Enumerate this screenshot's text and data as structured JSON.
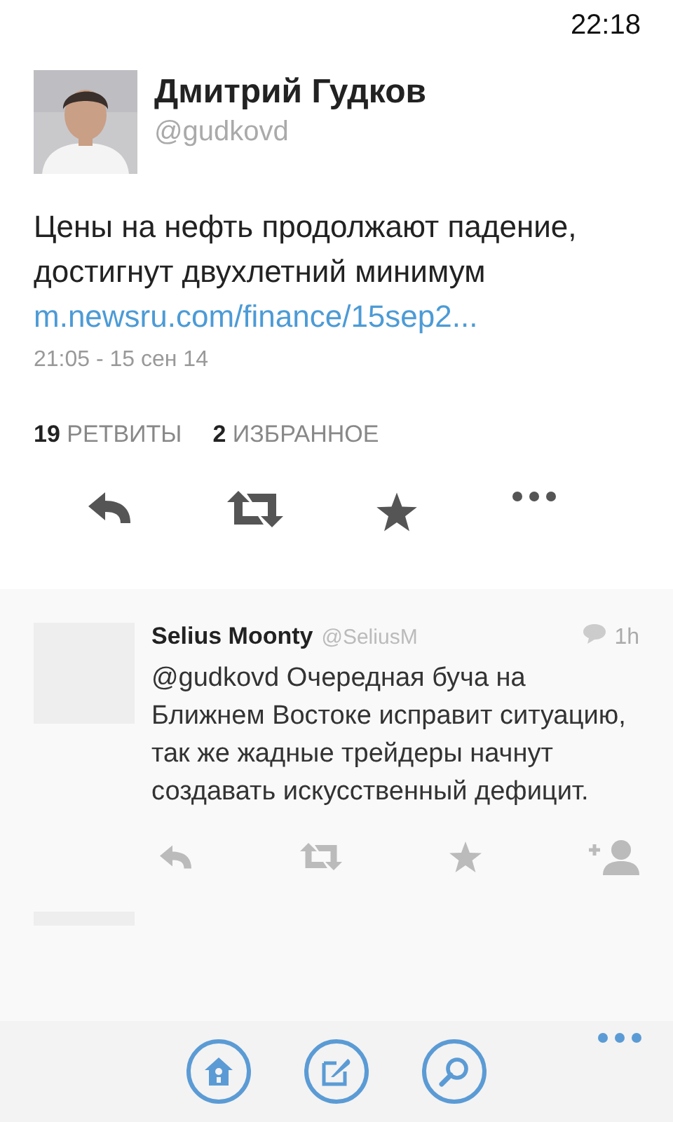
{
  "status_bar": {
    "time": "22:18"
  },
  "tweet": {
    "author": "Дмитрий Гудков",
    "handle": "@gudkovd",
    "text": "Цены на нефть продолжают падение, достигнут двухлетний минимум",
    "link": "m.newsru.com/finance/15sep2...",
    "date": "21:05 - 15 сен 14",
    "stats": [
      {
        "count": "19",
        "label": "РЕТВИТЫ"
      },
      {
        "count": "2",
        "label": "ИЗБРАННОЕ"
      }
    ]
  },
  "replies": [
    {
      "author": "Selius Moonty",
      "handle": "@SeliusM",
      "age": "1h",
      "text": "@gudkovd Очередная буча на Ближнем Востоке исправит ситуацию, так же жадные трейдеры начнут создавать искусственный дефицит."
    }
  ]
}
